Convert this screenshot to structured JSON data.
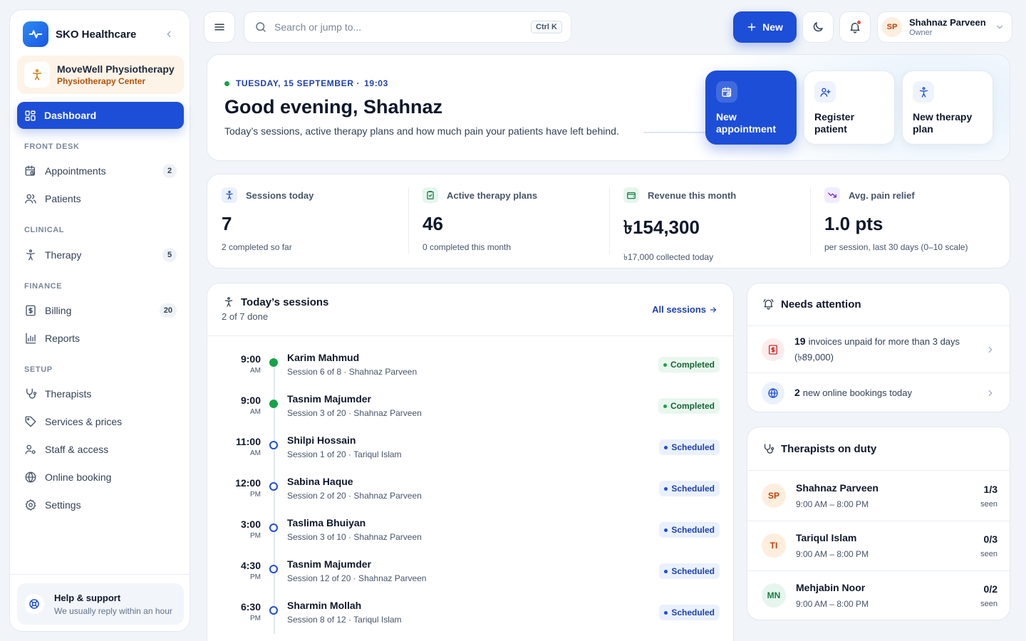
{
  "brand": {
    "name": "SKO Healthcare"
  },
  "clinic": {
    "name": "MoveWell Physiotherapy",
    "type": "Physiotherapy Center"
  },
  "nav": {
    "dashboard": "Dashboard",
    "sections": {
      "front_desk": "FRONT DESK",
      "clinical": "CLINICAL",
      "finance": "FINANCE",
      "setup": "SETUP"
    },
    "items": [
      {
        "label": "Appointments",
        "count": "2"
      },
      {
        "label": "Patients",
        "count": ""
      },
      {
        "label": "Therapy",
        "count": "5"
      },
      {
        "label": "Billing",
        "count": "20"
      },
      {
        "label": "Reports",
        "count": ""
      },
      {
        "label": "Therapists",
        "count": ""
      },
      {
        "label": "Services & prices",
        "count": ""
      },
      {
        "label": "Staff & access",
        "count": ""
      },
      {
        "label": "Online booking",
        "count": ""
      },
      {
        "label": "Settings",
        "count": ""
      }
    ]
  },
  "help": {
    "title": "Help & support",
    "subtitle": "We usually reply within an hour"
  },
  "topbar": {
    "search_placeholder": "Search or jump to...",
    "shortcut": "Ctrl K",
    "new_label": "New"
  },
  "user": {
    "initials": "SP",
    "name": "Shahnaz Parveen",
    "role": "Owner"
  },
  "hero": {
    "date": "TUESDAY, 15 SEPTEMBER",
    "separator": "·",
    "time": "19:03",
    "title": "Good evening, Shahnaz",
    "subtitle": "Today’s sessions, active therapy plans and how much pain your patients have left behind.",
    "actions": [
      "New appointment",
      "Register patient",
      "New therapy plan"
    ]
  },
  "stats": [
    {
      "label": "Sessions today",
      "value": "7",
      "sub": "2 completed so far"
    },
    {
      "label": "Active therapy plans",
      "value": "46",
      "sub": "0 completed this month"
    },
    {
      "label": "Revenue this month",
      "value": "৳154,300",
      "sub": "৳17,000 collected today"
    },
    {
      "label": "Avg. pain relief",
      "value": "1.0 pts",
      "sub": "per session, last 30 days (0–10 scale)"
    }
  ],
  "sessions": {
    "title": "Today’s sessions",
    "subtitle": "2 of 7 done",
    "link": "All sessions",
    "rows": [
      {
        "time": "9:00",
        "ampm": "AM",
        "name": "Karim Mahmud",
        "detail": "Session 6 of 8 · Shahnaz Parveen",
        "status": "Completed"
      },
      {
        "time": "9:00",
        "ampm": "AM",
        "name": "Tasnim Majumder",
        "detail": "Session 3 of 20 · Shahnaz Parveen",
        "status": "Completed"
      },
      {
        "time": "11:00",
        "ampm": "AM",
        "name": "Shilpi Hossain",
        "detail": "Session 1 of 20 · Tariqul Islam",
        "status": "Scheduled"
      },
      {
        "time": "12:00",
        "ampm": "PM",
        "name": "Sabina Haque",
        "detail": "Session 2 of 20 · Shahnaz Parveen",
        "status": "Scheduled"
      },
      {
        "time": "3:00",
        "ampm": "PM",
        "name": "Taslima Bhuiyan",
        "detail": "Session 3 of 10 · Shahnaz Parveen",
        "status": "Scheduled"
      },
      {
        "time": "4:30",
        "ampm": "PM",
        "name": "Tasnim Majumder",
        "detail": "Session 12 of 20 · Shahnaz Parveen",
        "status": "Scheduled"
      },
      {
        "time": "6:30",
        "ampm": "PM",
        "name": "Sharmin Mollah",
        "detail": "Session 8 of 12 · Tariqul Islam",
        "status": "Scheduled"
      }
    ]
  },
  "attention": {
    "title": "Needs attention",
    "items": [
      {
        "count": "19",
        "text": "invoices unpaid for more than 3 days (৳89,000)"
      },
      {
        "count": "2",
        "text": "new online bookings today"
      }
    ]
  },
  "duty": {
    "title": "Therapists on duty",
    "seen_label": "seen",
    "rows": [
      {
        "initials": "SP",
        "name": "Shahnaz Parveen",
        "hours": "9:00 AM – 8:00 PM",
        "count": "1/3"
      },
      {
        "initials": "TI",
        "name": "Tariqul Islam",
        "hours": "9:00 AM – 8:00 PM",
        "count": "0/3"
      },
      {
        "initials": "MN",
        "name": "Mehjabin Noor",
        "hours": "9:00 AM – 8:00 PM",
        "count": "0/2"
      }
    ]
  },
  "colors": {
    "accent": "#1d4ed8",
    "success": "#16a34a",
    "danger": "#ef4444",
    "clinic_bg": "#fdf3e7"
  }
}
